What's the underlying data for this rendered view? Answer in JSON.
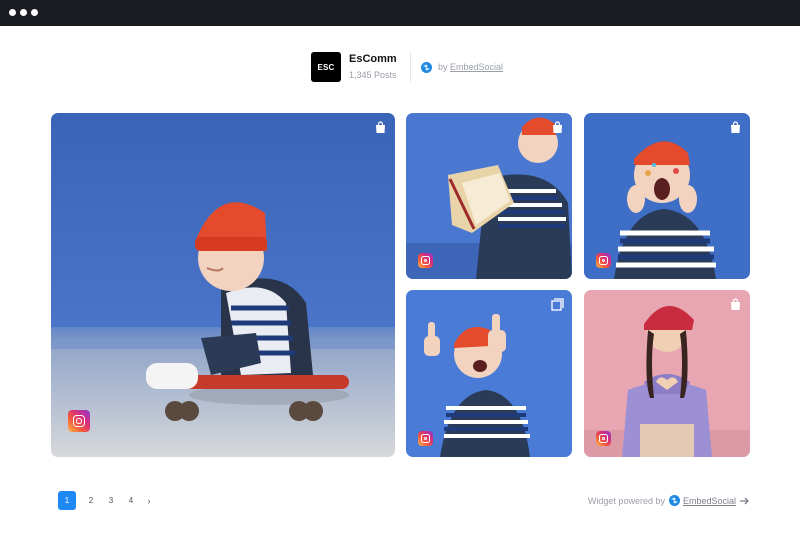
{
  "window": {
    "controls": [
      "dot",
      "dot",
      "dot"
    ]
  },
  "profile": {
    "logo_text": "ESC",
    "name": "EsComm",
    "posts": "1,345 Posts",
    "by_prefix": "by",
    "by_link": "EmbedSocial"
  },
  "feed": {
    "tiles": [
      {
        "kind": "shopping-bag-icon",
        "source": "instagram-icon",
        "subject": "Child in red beanie on skateboard"
      },
      {
        "kind": "shopping-bag-icon",
        "source": "instagram-icon",
        "subject": "Child reading a book"
      },
      {
        "kind": "shopping-bag-icon",
        "source": "instagram-icon",
        "subject": "Surprised child with stickers"
      },
      {
        "kind": "carousel-icon",
        "source": "instagram-icon",
        "subject": "Child giving thumbs up"
      },
      {
        "kind": "shopping-bag-icon",
        "source": "instagram-icon",
        "subject": "Woman making heart with hands"
      }
    ]
  },
  "pagination": {
    "pages": [
      "1",
      "2",
      "3",
      "4"
    ],
    "current": "1",
    "next": "›"
  },
  "footer": {
    "powered_prefix": "Widget powered by",
    "powered_link": "EmbedSocial"
  },
  "colors": {
    "accent": "#1e88f5",
    "titlebar": "#1b1c22"
  }
}
